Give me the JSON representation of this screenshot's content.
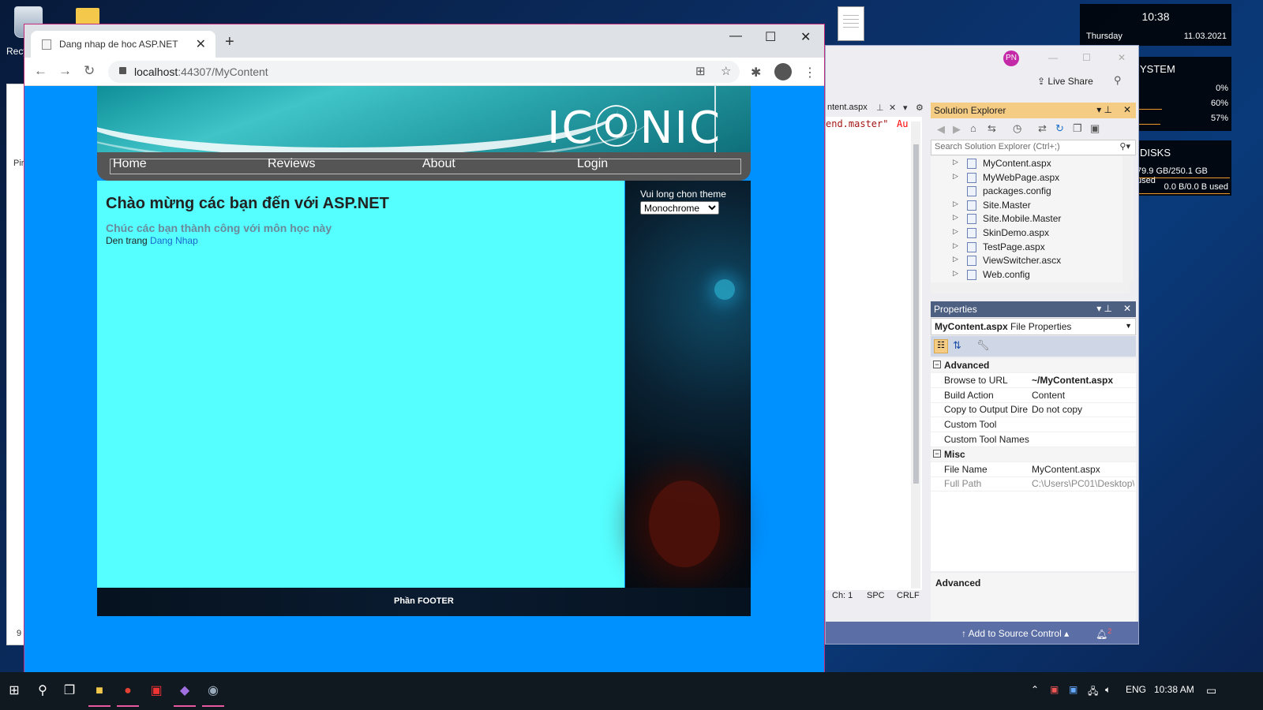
{
  "desktop": {
    "recycle_label": "Recy",
    "left_win_texts": [
      "Pir",
      "9"
    ]
  },
  "widgets": {
    "clock": {
      "time": "10:38",
      "day": "Thursday",
      "date": "11.03.2021"
    },
    "system": {
      "title": "YSTEM",
      "rows": [
        "0%",
        "60%",
        "57%"
      ]
    },
    "disks": {
      "title": "DISKS",
      "rows": [
        "79.9 GB/250.1 GB used",
        "0.0 B/0.0 B used"
      ]
    }
  },
  "browser": {
    "tab_title": "Dang nhap de hoc ASP.NET",
    "url_host": "localhost",
    "url_rest": ":44307/MyContent",
    "controls": {
      "minimize": "—",
      "maximize": "☐",
      "close": "✕",
      "new_tab": "+",
      "tab_close": "✕"
    }
  },
  "site": {
    "logo": "ICⓄNIC",
    "menu": [
      "Home",
      "Reviews",
      "About",
      "Login"
    ],
    "heading": "Chào mừng các bạn đến với ASP.NET",
    "subheading": "Chúc các bạn thành công với môn học này",
    "link_prefix": "Den trang ",
    "link_text": "Dang Nhap",
    "theme_label": "Vui long chon theme",
    "theme_selected": "Monochrome",
    "footer": "Phần FOOTER"
  },
  "vs": {
    "avatar": "PN",
    "live_share": "Live Share",
    "doc_tab": "ntent.aspx",
    "code_a": "end.master\"",
    "code_b": "Au",
    "status": {
      "ch": "Ch: 1",
      "spc": "SPC",
      "crlf": "CRLF"
    },
    "add_source": "Add to Source Control",
    "notif_count": "2",
    "solution_explorer": {
      "title": "Solution Explorer",
      "search_placeholder": "Search Solution Explorer (Ctrl+;)",
      "items": [
        {
          "label": "MyContent.aspx",
          "expandable": true
        },
        {
          "label": "MyWebPage.aspx",
          "expandable": true
        },
        {
          "label": "packages.config",
          "expandable": false
        },
        {
          "label": "Site.Master",
          "expandable": true
        },
        {
          "label": "Site.Mobile.Master",
          "expandable": true
        },
        {
          "label": "SkinDemo.aspx",
          "expandable": true
        },
        {
          "label": "TestPage.aspx",
          "expandable": true
        },
        {
          "label": "ViewSwitcher.ascx",
          "expandable": true
        },
        {
          "label": "Web.config",
          "expandable": true
        }
      ]
    },
    "properties": {
      "title": "Properties",
      "object_name": "MyContent.aspx",
      "object_type": "File Properties",
      "categories": [
        {
          "name": "Advanced",
          "rows": [
            {
              "k": "Browse to URL",
              "v": "~/MyContent.aspx",
              "bold": true
            },
            {
              "k": "Build Action",
              "v": "Content"
            },
            {
              "k": "Copy to Output Dire",
              "v": "Do not copy"
            },
            {
              "k": "Custom Tool",
              "v": ""
            },
            {
              "k": "Custom Tool Names",
              "v": ""
            }
          ]
        },
        {
          "name": "Misc",
          "rows": [
            {
              "k": "File Name",
              "v": "MyContent.aspx"
            },
            {
              "k": "Full Path",
              "v": "C:\\Users\\PC01\\Desktop\\",
              "dim": true
            }
          ]
        }
      ],
      "description": "Advanced"
    }
  },
  "taskbar": {
    "lang": "ENG",
    "time": "10:38 AM"
  }
}
